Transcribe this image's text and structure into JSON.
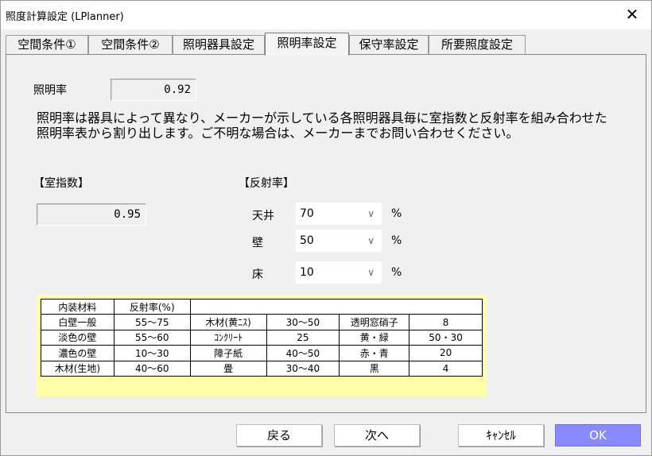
{
  "window": {
    "title": "照度計算設定 (LPlanner)",
    "close_glyph": "✕"
  },
  "tabs": [
    {
      "label": "空間条件①"
    },
    {
      "label": "空間条件②"
    },
    {
      "label": "照明器具設定"
    },
    {
      "label": "照明率設定"
    },
    {
      "label": "保守率設定"
    },
    {
      "label": "所要照度設定"
    }
  ],
  "active_tab": "照明率設定",
  "utilization": {
    "label": "照明率",
    "value": "0.92"
  },
  "description": "照明率は器具によって異なり、メーカーが示している各照明器具毎に室指数と反射率を組み合わせた照明率表から割り出します。ご不明な場合は、メーカーまでお問い合わせください。",
  "room_index": {
    "heading": "【室指数】",
    "value": "0.95"
  },
  "reflectance": {
    "heading": "【反射率】",
    "rows": [
      {
        "label": "天井",
        "value": "70",
        "unit": "%"
      },
      {
        "label": "壁",
        "value": "50",
        "unit": "%"
      },
      {
        "label": "床",
        "value": "10",
        "unit": "%"
      }
    ]
  },
  "ref_table": {
    "header": [
      "内装材料",
      "反射率(%)"
    ],
    "rows": [
      [
        "白壁一般",
        "55～75",
        "木材(黄ﾆｽ)",
        "30～50",
        "透明窓硝子",
        "8"
      ],
      [
        "淡色の壁",
        "55～60",
        "ｺﾝｸﾘｰﾄ",
        "25",
        "黄・緑",
        "50・30"
      ],
      [
        "濃色の壁",
        "10～30",
        "障子紙",
        "40～50",
        "赤・青",
        "20"
      ],
      [
        "木材(生地)",
        "40～60",
        "畳",
        "30～40",
        "黒",
        "4"
      ]
    ]
  },
  "buttons": {
    "back": "戻る",
    "next": "次へ",
    "cancel": "ｷｬﾝｾﾙ",
    "ok": "OK"
  },
  "colors": {
    "ok_button": "#8a8aff",
    "table_frame": "#ffffaa"
  }
}
